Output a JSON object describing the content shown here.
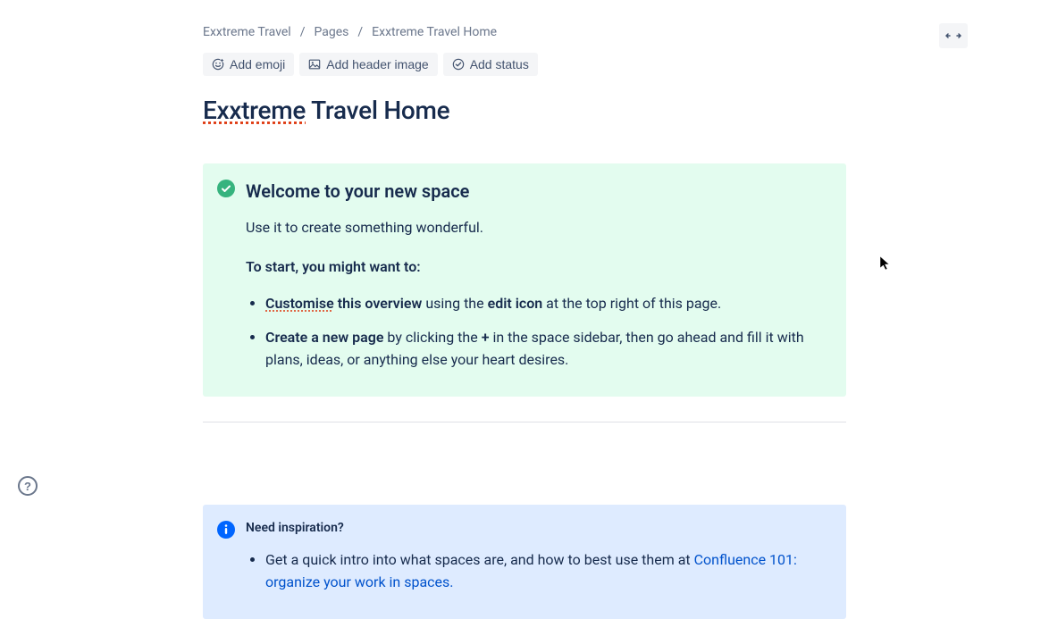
{
  "breadcrumb": {
    "items": [
      {
        "label": "Exxtreme Travel"
      },
      {
        "label": "Pages"
      },
      {
        "label": "Exxtreme Travel Home"
      }
    ]
  },
  "toolbar": {
    "add_emoji": "Add emoji",
    "add_header_image": "Add header image",
    "add_status": "Add status"
  },
  "title": {
    "word_misspelled": "Exxtreme",
    "rest": " Travel Home"
  },
  "welcome_panel": {
    "heading": "Welcome to your new space",
    "paragraph": "Use it to create something wonderful.",
    "subheading": "To start, you might want to:",
    "bullet1": {
      "strong_misspelled": "Customise",
      "strong_rest": " this overview",
      "mid": " using the ",
      "strong2": "edit icon",
      "tail": " at the top right of this page."
    },
    "bullet2": {
      "strong": "Create a new page",
      "mid1": " by clicking the ",
      "plus": "+",
      "tail": " in the space sidebar, then go ahead and fill it with plans, ideas, or anything else your heart desires."
    }
  },
  "info_panel": {
    "heading": "Need inspiration?",
    "bullet1": {
      "lead": "Get a quick intro into what spaces are, and how to best use them at ",
      "link": "Confluence 101: organize your work in spaces.",
      "tail": ""
    }
  }
}
